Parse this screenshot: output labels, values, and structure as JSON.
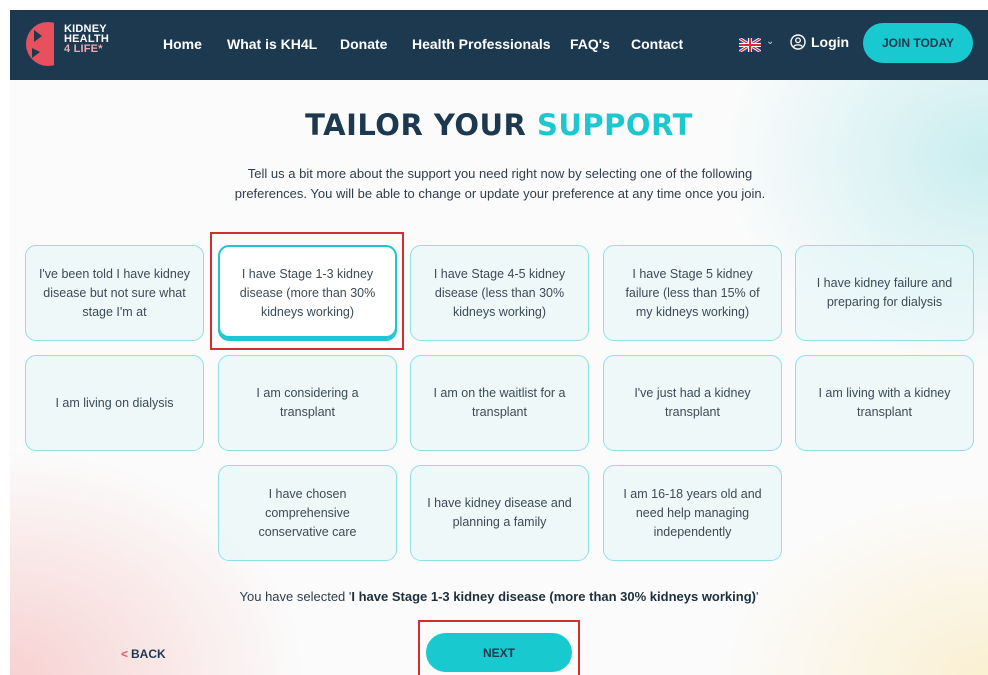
{
  "nav": {
    "logo": {
      "line1": "KIDNEY",
      "line2": "HEALTH",
      "line3": "4 LIFE*"
    },
    "links": [
      "Home",
      "What is KH4L",
      "Donate",
      "Health Professionals",
      "FAQ's",
      "Contact"
    ],
    "language_icon": "uk-flag-icon",
    "login_label": "Login",
    "join_label": "JOIN TODAY"
  },
  "heading": {
    "part1": "TAILOR YOUR ",
    "part2": "SUPPORT"
  },
  "subtitle": "Tell us a bit more about the support you need right now by selecting one of the following preferences. You will be able to change or update your preference at any time once you join.",
  "options": [
    "I've been told I have kidney disease but not sure what stage I'm at",
    "I have Stage 1-3 kidney disease (more than 30% kidneys working)",
    "I have Stage 4-5 kidney disease (less than 30% kidneys working)",
    "I have Stage 5 kidney failure (less than 15% of my kidneys working)",
    "I have kidney failure and preparing for dialysis",
    "I am living on dialysis",
    "I am considering a transplant",
    "I am on the waitlist for a transplant",
    "I've just had a kidney transplant",
    "I am living with a kidney transplant",
    "I have chosen comprehensive conservative care",
    "I have kidney disease and planning a family",
    "I am 16-18 years old and need help managing independently"
  ],
  "selected_index": 1,
  "selection": {
    "prefix": "You have selected '",
    "value": "I have Stage 1-3 kidney disease (more than 30% kidneys working)",
    "suffix": "'"
  },
  "footer": {
    "back_label": "BACK",
    "back_arrow": "<",
    "next_label": "NEXT"
  },
  "colors": {
    "navy": "#1d3950",
    "teal": "#1cc7cf",
    "highlight": "#d32f2f"
  }
}
